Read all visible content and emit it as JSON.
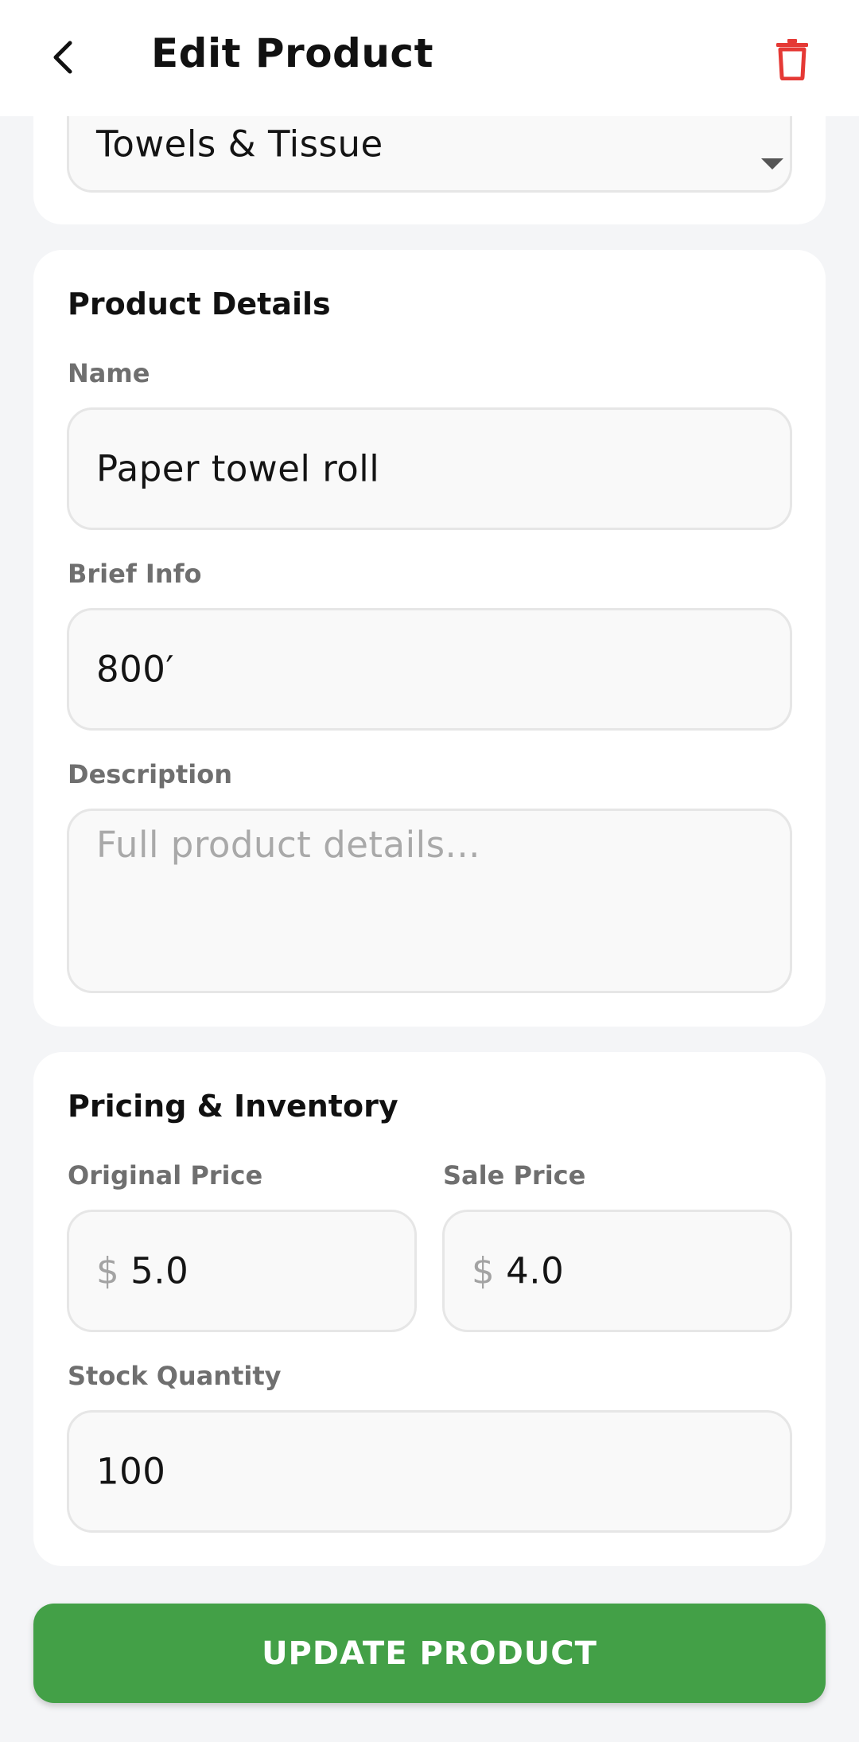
{
  "appbar": {
    "title": "Edit Product",
    "back_icon": "chevron-left-icon",
    "delete_icon": "trash-icon",
    "delete_color": "#e53935"
  },
  "category": {
    "selected": "Towels & Tissue"
  },
  "details": {
    "section_title": "Product Details",
    "name_label": "Name",
    "name_value": "Paper towel roll",
    "brief_label": "Brief Info",
    "brief_value": "800′",
    "description_label": "Description",
    "description_placeholder": "Full product details..."
  },
  "pricing": {
    "section_title": "Pricing & Inventory",
    "original_label": "Original Price",
    "original_value": "5.0",
    "sale_label": "Sale Price",
    "sale_value": "4.0",
    "currency_symbol": "$",
    "stock_label": "Stock Quantity",
    "stock_value": "100"
  },
  "actions": {
    "update_label": "UPDATE PRODUCT",
    "update_color": "#43a047"
  }
}
